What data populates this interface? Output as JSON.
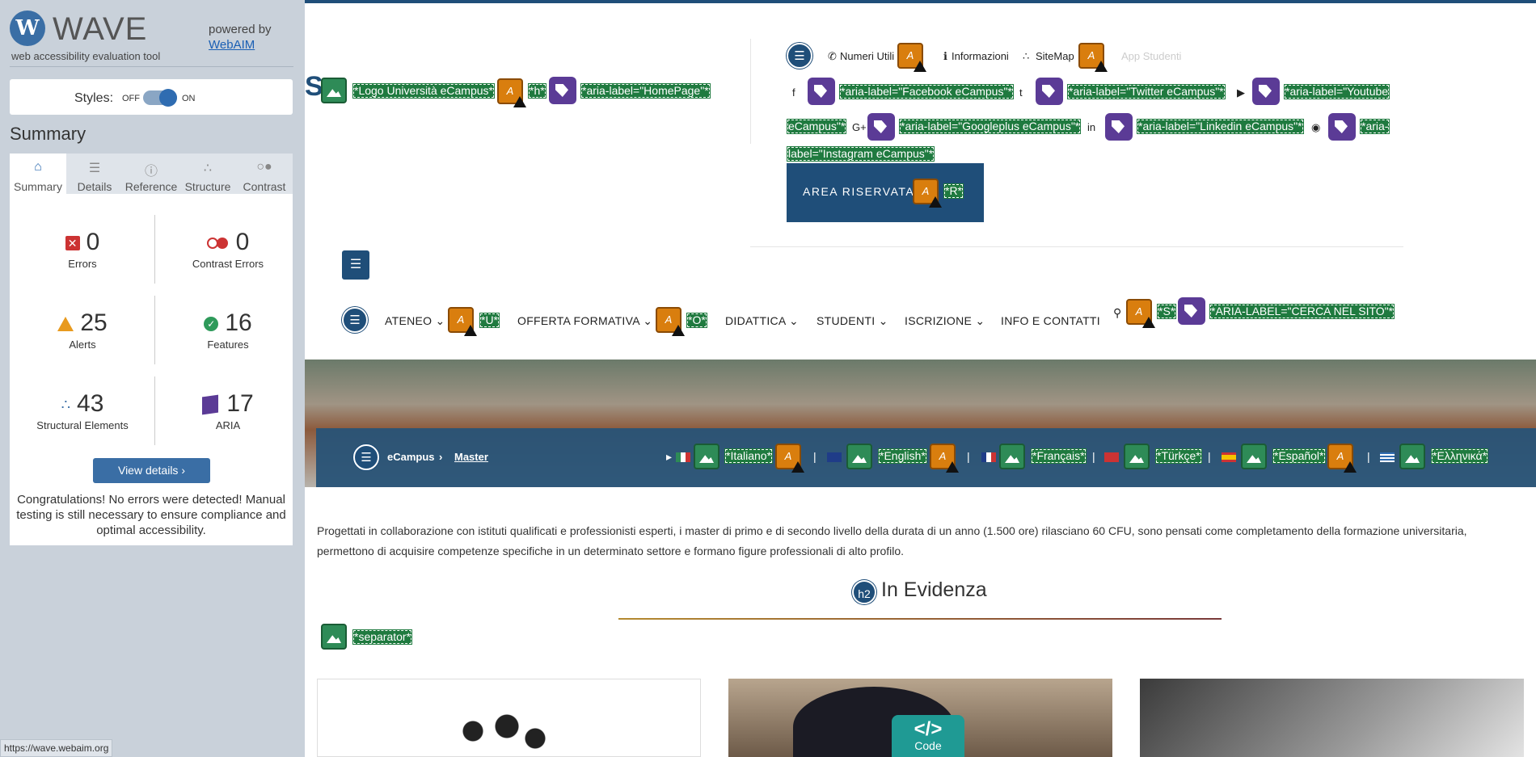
{
  "sidebar": {
    "logo_letter": "W",
    "logo_word": "WAVE",
    "tagline": "web accessibility evaluation tool",
    "powered_by": "powered by",
    "powered_link": "WebAIM",
    "styles_label": "Styles:",
    "styles_off": "OFF",
    "styles_on": "ON",
    "summary_title": "Summary",
    "tabs": [
      {
        "label": "Summary",
        "icon": "home-icon",
        "glyph": "⌂"
      },
      {
        "label": "Details",
        "icon": "list-icon",
        "glyph": "☰"
      },
      {
        "label": "Reference",
        "icon": "info-icon",
        "glyph": "ⓘ"
      },
      {
        "label": "Structure",
        "icon": "structure-icon",
        "glyph": "∴"
      },
      {
        "label": "Contrast",
        "icon": "contrast-icon",
        "glyph": "○●"
      }
    ],
    "stats": {
      "errors": {
        "count": "0",
        "label": "Errors",
        "glyph": "✕"
      },
      "contrast": {
        "count": "0",
        "label": "Contrast Errors"
      },
      "alerts": {
        "count": "25",
        "label": "Alerts"
      },
      "features": {
        "count": "16",
        "label": "Features",
        "glyph": "✓"
      },
      "structural": {
        "count": "43",
        "label": "Structural Elements",
        "glyph": "∴"
      },
      "aria": {
        "count": "17",
        "label": "ARIA"
      }
    },
    "view_details": "View details ›",
    "congrats": "Congratulations! No errors were detected! Manual testing is still necessary to ensure compliance and optimal accessibility.",
    "status_url": "https://wave.webaim.org"
  },
  "colors": {
    "sidebar_bg": "#c9d1da",
    "accent": "#3a6ea5",
    "error": "#cc3333",
    "alert": "#e89a1e",
    "feature": "#2e9a5a",
    "aria": "#5b3b96",
    "site_blue": "#1f4e79"
  },
  "site": {
    "header_s": "S",
    "logo_alt": "*Logo Università eCampus*",
    "h_tag": "*h*",
    "homepage_aria": "*aria-label=\"HomePage\"*",
    "util": {
      "numeri": "Numeri Utili",
      "informazioni": "Informazioni",
      "sitemap": "SiteMap",
      "app": "App Studenti"
    },
    "social": {
      "facebook": "*aria-label=\"Facebook eCampus\"*",
      "twitter": "*aria-label=\"Twitter eCampus\"*",
      "youtube_a": "*aria-label=\"Youtube",
      "youtube_b": "eCampus\"*",
      "google": "*aria-label=\"Googleplus eCampus\"*",
      "linkedin": "*aria-label=\"Linkedin eCampus\"*",
      "instagram_a": "*aria-",
      "instagram_b": "label=\"Instagram eCampus\"*"
    },
    "area_riservata": "AREA RISERVATA",
    "r_tag": "*R*",
    "nav": {
      "ateneo": "ATENEO",
      "u_tag": "*U*",
      "offerta": "OFFERTA FORMATIVA",
      "o_tag": "*O*",
      "didattica": "DIDATTICA",
      "studenti": "STUDENTI",
      "iscrizione": "ISCRIZIONE",
      "info": "INFO E CONTATTI",
      "s_tag": "*S*",
      "cerca": "*ARIA-LABEL=\"CERCA NEL SITO\"*"
    },
    "breadcrumb": {
      "home": "eCampus",
      "sep": "›",
      "current": "Master"
    },
    "languages": {
      "italiano": "*Italiano*",
      "english": "*English*",
      "francais": "*Français*",
      "turkce": "*Türkçe*",
      "espanol": "*Español*",
      "greek": "*Ελληνικά*"
    },
    "intro": "Progettati in collaborazione con istituti qualificati e professionisti esperti, i master di primo e di secondo livello della durata di un anno (1.500 ore) rilasciano 60 CFU, sono pensati come completamento della formazione universitaria, permettono di acquisire competenze specifiche in un determinato settore e formano figure professionali di alto profilo.",
    "h2_badge": "h2",
    "section_title": "In Evidenza",
    "separator": "*separator*",
    "code_glyph": "</>",
    "code_label": "Code"
  }
}
